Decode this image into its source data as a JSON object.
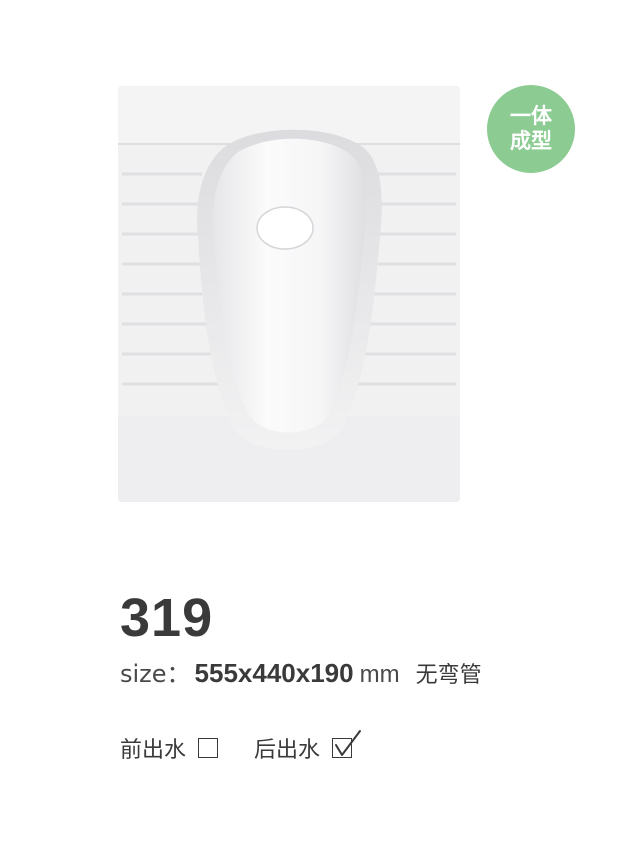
{
  "badge": {
    "line1": "一体",
    "line2": "成型"
  },
  "product": {
    "model": "319",
    "size_label": "size：",
    "size_value": "555x440x190",
    "size_unit": "mm",
    "size_note": "无弯管"
  },
  "options": [
    {
      "label": "前出水",
      "checked": false
    },
    {
      "label": "后出水",
      "checked": true
    }
  ],
  "colors": {
    "badge": "#8ccc92",
    "text": "#3a3a3a",
    "ceramic": "#f0f0f1"
  },
  "icons": {
    "checkbox": "checkbox-icon",
    "checkmark": "checkmark-icon"
  }
}
